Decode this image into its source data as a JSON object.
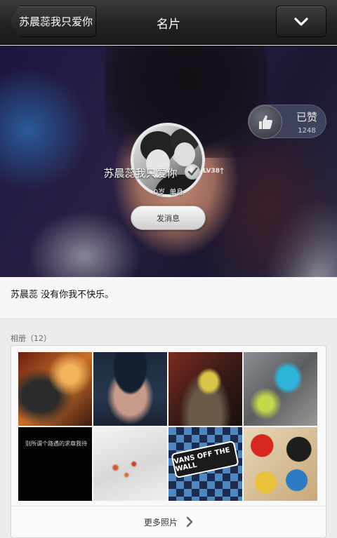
{
  "nav": {
    "back_label": "苏晨蕊我只爱你",
    "title": "名片",
    "menu_icon": "chevron-down-icon"
  },
  "profile": {
    "like_label": "已赞",
    "like_count": "1248",
    "username": "苏晨蕊我只爱你",
    "level": "LV38",
    "age": "0岁",
    "relationship": "单身",
    "message_button": "发消息"
  },
  "signature": {
    "text": "苏晨蕊    没有你我不快乐。"
  },
  "album": {
    "label": "相册（12）",
    "photo5_caption": "别所谓个路遇的求章我待",
    "photo7_text": "VANS OFF THE WALL",
    "more_label": "更多照片"
  },
  "colors": {
    "topbar": "#222222",
    "background": "#ececec",
    "card": "#fafafa"
  }
}
